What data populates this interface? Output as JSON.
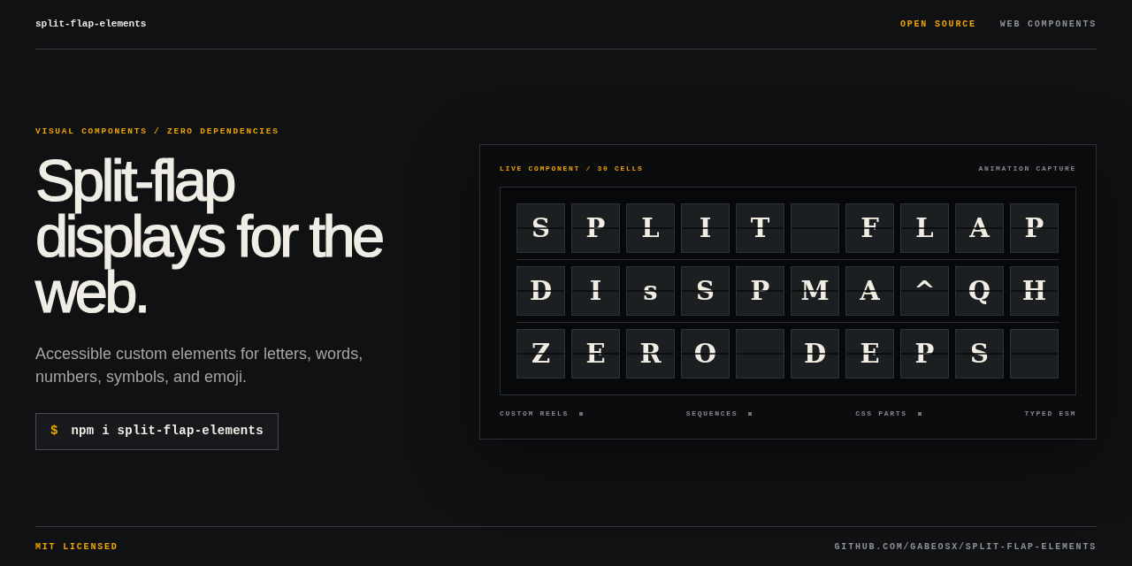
{
  "header": {
    "logo": "split-flap-elements",
    "nav": [
      {
        "label": "OPEN SOURCE",
        "selected": true
      },
      {
        "label": "WEB COMPONENTS",
        "selected": false
      }
    ]
  },
  "hero": {
    "eyebrow": "VISUAL COMPONENTS / ZERO DEPENDENCIES",
    "heading": "Split-flap displays for the web.",
    "description": "Accessible custom elements for letters, words, numbers, symbols, and emoji.",
    "command": {
      "prompt": "$",
      "text": "npm i split-flap-elements"
    }
  },
  "display": {
    "label": "LIVE COMPONENT / 30 CELLS",
    "caption": "ANIMATION CAPTURE",
    "rows": [
      {
        "cells": [
          {
            "kind": "letter",
            "char": "S"
          },
          {
            "kind": "letter",
            "char": "P"
          },
          {
            "kind": "letter",
            "char": "L"
          },
          {
            "kind": "letter",
            "char": "I"
          },
          {
            "kind": "letter",
            "char": "T"
          },
          {
            "kind": "blank"
          },
          {
            "kind": "letter",
            "char": "F"
          },
          {
            "kind": "letter",
            "char": "L"
          },
          {
            "kind": "letter",
            "char": "A"
          },
          {
            "kind": "letter",
            "char": "P"
          }
        ]
      },
      {
        "cells": [
          {
            "kind": "letter",
            "char": "D"
          },
          {
            "kind": "letter",
            "char": "I"
          },
          {
            "kind": "letter",
            "char": "s"
          },
          {
            "kind": "letter",
            "char": "S"
          },
          {
            "kind": "letter",
            "char": "P"
          },
          {
            "kind": "letter",
            "char": "M"
          },
          {
            "kind": "letter",
            "char": "A"
          },
          {
            "kind": "letter",
            "char": "^"
          },
          {
            "kind": "letter",
            "char": "Q"
          },
          {
            "kind": "letter",
            "char": "H"
          }
        ]
      },
      {
        "cells": [
          {
            "kind": "letter",
            "char": "Z"
          },
          {
            "kind": "letter",
            "char": "E"
          },
          {
            "kind": "letter",
            "char": "R"
          },
          {
            "kind": "letter",
            "char": "O"
          },
          {
            "kind": "blank"
          },
          {
            "kind": "letter",
            "char": "D"
          },
          {
            "kind": "letter",
            "char": "E"
          },
          {
            "kind": "letter",
            "char": "P"
          },
          {
            "kind": "letter",
            "char": "S"
          },
          {
            "kind": "blank"
          }
        ]
      }
    ],
    "features": [
      "CUSTOM REELS",
      "SEQUENCES",
      "CSS PARTS",
      "TYPED ESM"
    ]
  },
  "footer": {
    "license": "MIT LICENSED",
    "repo_link": "GITHUB.COM/GABEOSX/SPLIT-FLAP-ELEMENTS"
  }
}
